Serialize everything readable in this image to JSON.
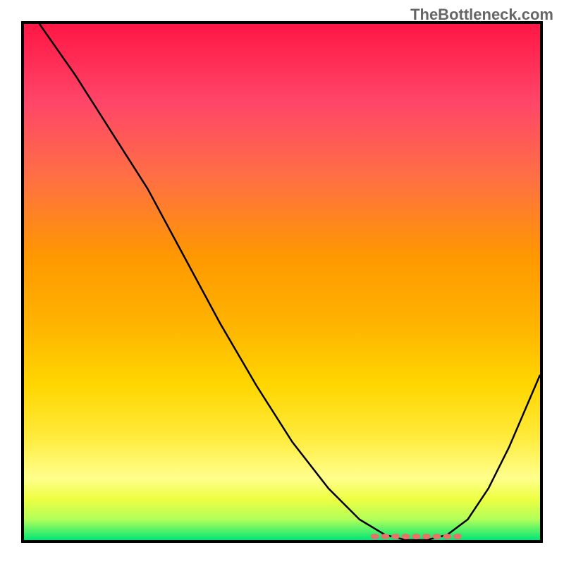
{
  "watermark": "TheBottleneck.com",
  "chart_data": {
    "type": "line",
    "title": "",
    "xlabel": "",
    "ylabel": "",
    "xlim": [
      0,
      100
    ],
    "ylim": [
      0,
      100
    ],
    "series": [
      {
        "name": "bottleneck-curve",
        "x": [
          3,
          10,
          17,
          24,
          31,
          38,
          45,
          52,
          59,
          65,
          70,
          74,
          78,
          82,
          86,
          90,
          94,
          100
        ],
        "y": [
          100,
          90,
          79,
          68,
          55,
          42,
          30,
          19,
          10,
          4,
          1,
          0,
          0,
          1,
          4,
          10,
          18,
          32
        ]
      }
    ],
    "minimum_zone": {
      "x_start": 68,
      "x_end": 84,
      "y": 0
    },
    "gradient": {
      "top_color": "#ff1744",
      "bottom_color": "#00e676",
      "description": "red-yellow-green"
    }
  }
}
